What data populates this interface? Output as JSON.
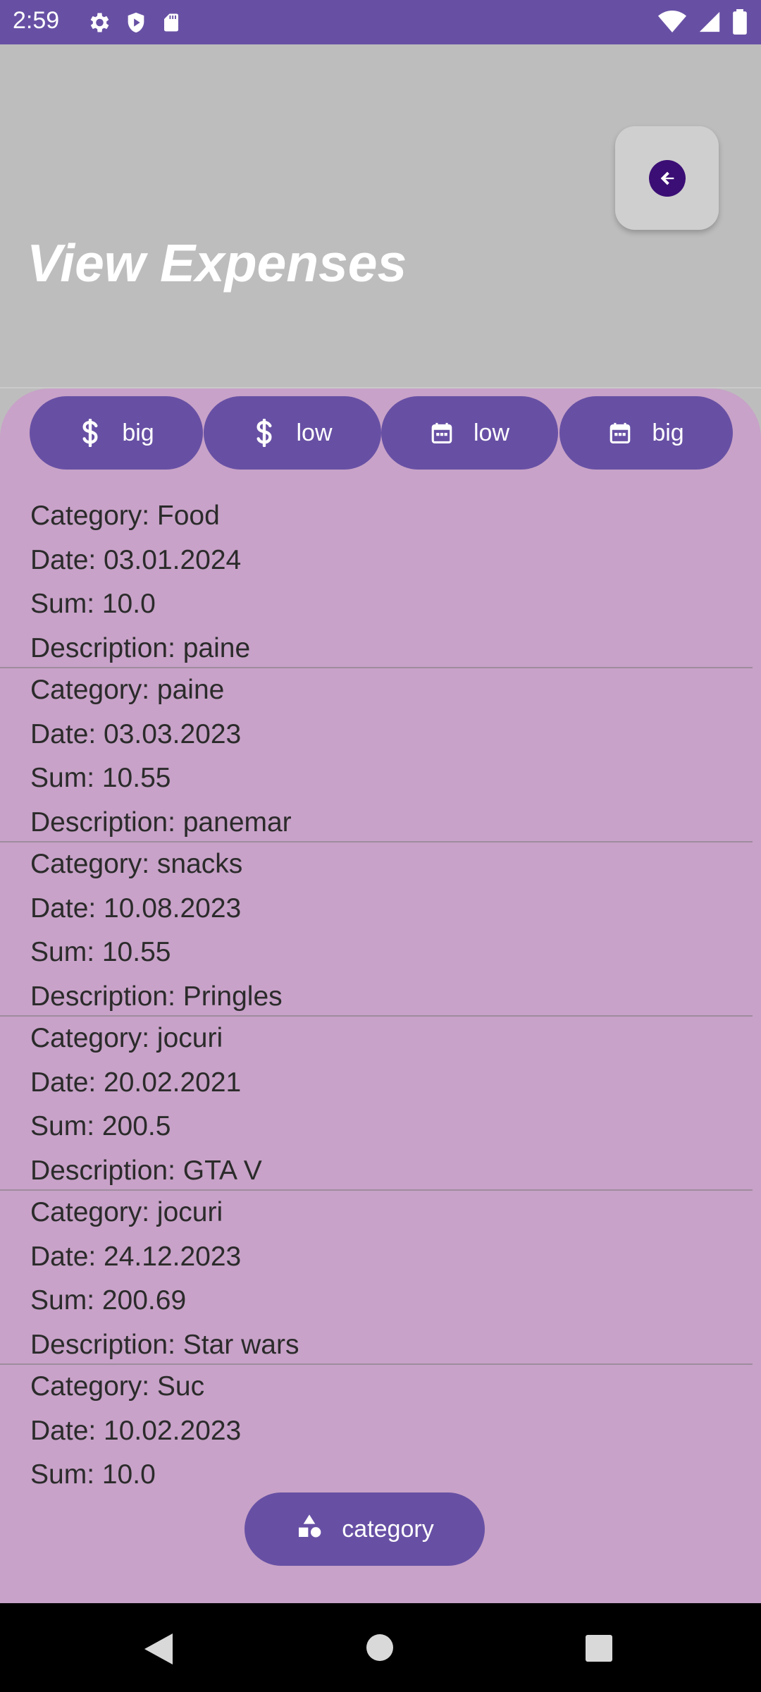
{
  "status_bar": {
    "time": "2:59",
    "icons_left": [
      "gear-icon",
      "shield-play-icon",
      "sd-card-icon"
    ],
    "icons_right": [
      "wifi-icon",
      "signal-icon",
      "battery-icon"
    ]
  },
  "header": {
    "title": "View Expenses",
    "back_button_icon": "arrow-back-icon"
  },
  "sort_chips": [
    {
      "icon": "dollar-icon",
      "label": "big"
    },
    {
      "icon": "dollar-icon",
      "label": "low"
    },
    {
      "icon": "calendar-icon",
      "label": "low"
    },
    {
      "icon": "calendar-icon",
      "label": "big"
    }
  ],
  "expenses": [
    {
      "category": "Category: Food",
      "date": "Date: 03.01.2024",
      "sum": "Sum: 10.0",
      "description": "Description: paine"
    },
    {
      "category": "Category: paine",
      "date": "Date: 03.03.2023",
      "sum": "Sum: 10.55",
      "description": "Description: panemar"
    },
    {
      "category": "Category: snacks",
      "date": "Date: 10.08.2023",
      "sum": "Sum: 10.55",
      "description": "Description: Pringles"
    },
    {
      "category": "Category: jocuri",
      "date": "Date: 20.02.2021",
      "sum": "Sum: 200.5",
      "description": "Description: GTA V"
    },
    {
      "category": "Category: jocuri",
      "date": "Date: 24.12.2023",
      "sum": "Sum: 200.69",
      "description": "Description: Star wars"
    },
    {
      "category": "Category: Suc",
      "date": "Date: 10.02.2023",
      "sum": "Sum: 10.0",
      "description": ""
    }
  ],
  "category_button": {
    "icon": "shapes-icon",
    "label": "category"
  },
  "colors": {
    "primary": "#6750a4",
    "panel": "#c8a2c8",
    "background": "#bdbdbd",
    "back_icon": "#3b0e75"
  }
}
